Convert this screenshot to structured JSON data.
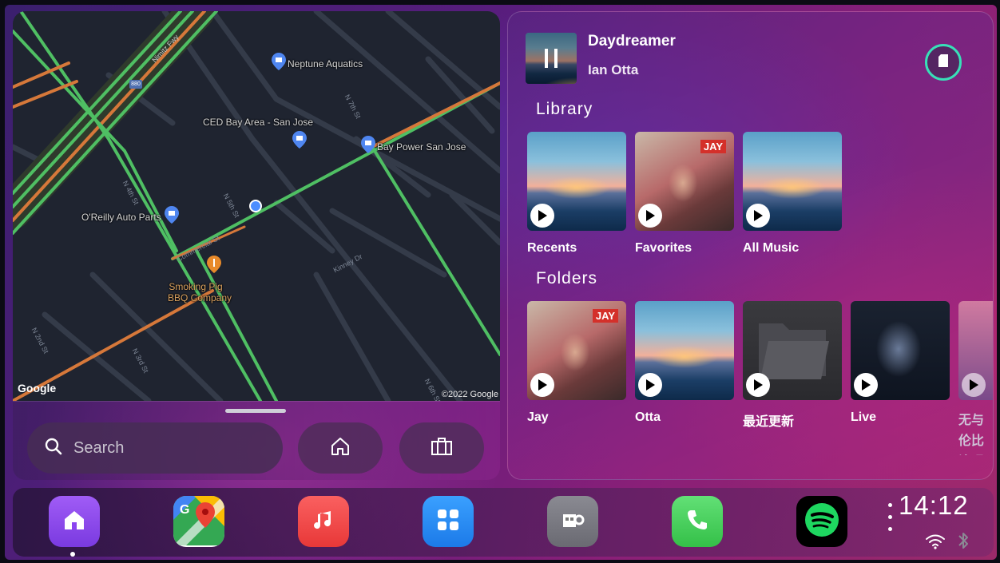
{
  "map": {
    "pois": [
      {
        "name": "Neptune Aquatics",
        "icon": "shop-pin-icon"
      },
      {
        "name": "CED Bay Area - San Jose",
        "icon": "shop-pin-icon"
      },
      {
        "name": "Bay Power San Jose",
        "icon": "shop-pin-icon"
      },
      {
        "name": "O'Reilly Auto Parts",
        "icon": "shop-pin-icon"
      },
      {
        "name": "Smoking Pig",
        "name2": "BBQ Company",
        "icon": "restaurant-pin-icon"
      }
    ],
    "streets": [
      "N 7th St",
      "N 4th St",
      "N 5th St",
      "Commercial St",
      "Kinney Dr",
      "N 2nd St",
      "N 3rd St",
      "N 6th St",
      "Nimitz Fwy"
    ],
    "highway_shield": "880",
    "google_logo": "Google",
    "copyright": "©2022 Google"
  },
  "nav_panel": {
    "search_placeholder": "Search",
    "search_icon": "search-icon",
    "home_icon": "home-icon",
    "work_icon": "briefcase-icon"
  },
  "now_playing": {
    "title": "Daydreamer",
    "artist": "Ian Otta",
    "state": "paused",
    "source_icon": "sd-card-icon",
    "accent": "#38e0b8"
  },
  "library": {
    "title": "Library",
    "items": [
      {
        "label": "Recents",
        "art": "ocean"
      },
      {
        "label": "Favorites",
        "art": "jay"
      },
      {
        "label": "All Music",
        "art": "ocean"
      }
    ]
  },
  "folders": {
    "title": "Folders",
    "items": [
      {
        "label": "Jay",
        "art": "jay"
      },
      {
        "label": "Otta",
        "art": "ocean"
      },
      {
        "label": "最近更新",
        "art": "folder"
      },
      {
        "label": "Live",
        "art": "live"
      },
      {
        "label": "无与伦比演唱会 Live",
        "art": "pink"
      }
    ]
  },
  "dock": {
    "apps": [
      {
        "name": "Home",
        "icon": "home-icon",
        "color": "#8a44f0"
      },
      {
        "name": "Google Maps",
        "icon": "google-maps-icon",
        "color": "#34a853"
      },
      {
        "name": "Music",
        "icon": "music-note-icon",
        "color": "#f24a4a"
      },
      {
        "name": "App Library",
        "icon": "grid-icon",
        "color": "#2a8cf0"
      },
      {
        "name": "Car Settings",
        "icon": "car-settings-icon",
        "color": "#7a7a84"
      },
      {
        "name": "Phone",
        "icon": "phone-icon",
        "color": "#4cd060"
      },
      {
        "name": "Spotify",
        "icon": "spotify-icon",
        "color": "#1ed760"
      }
    ],
    "time": "14:12",
    "status_icons": [
      "wifi-icon",
      "bluetooth-icon"
    ]
  }
}
